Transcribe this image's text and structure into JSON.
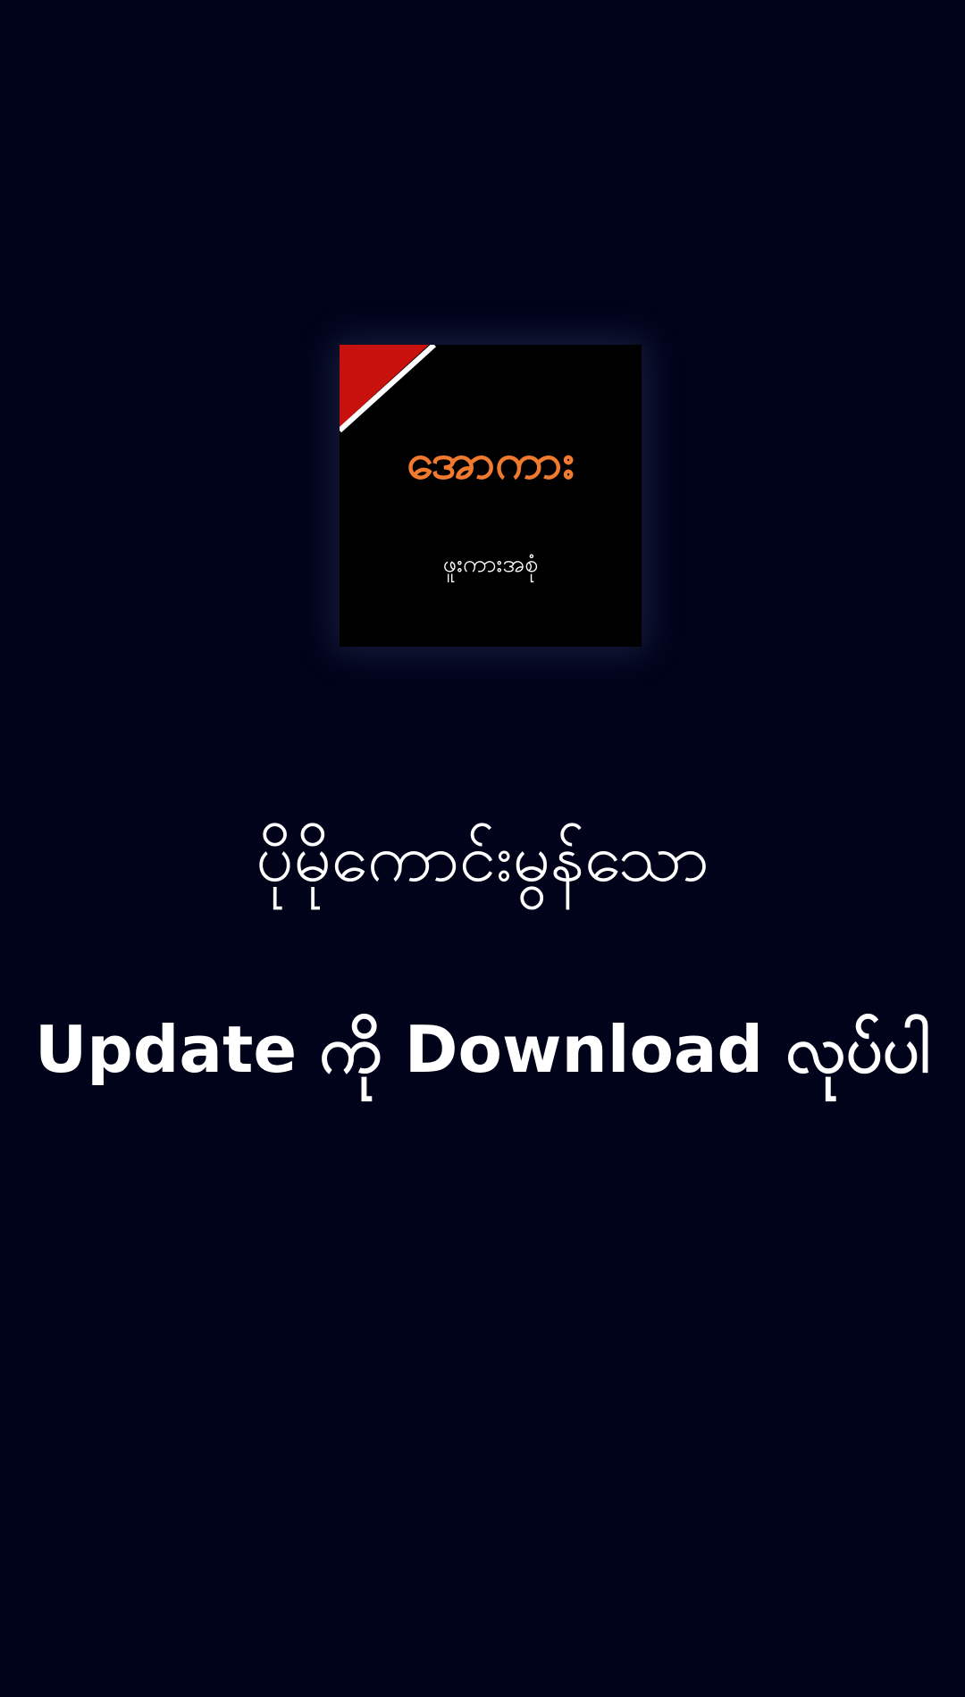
{
  "colors": {
    "background": "#01031a",
    "logo_background": "#000000",
    "logo_title": "#f27a2e",
    "logo_accent_red": "#c8100c",
    "logo_accent_stripe": "#ffffff",
    "text": "#ffffff"
  },
  "logo": {
    "icon": "app-logo-icon",
    "title": "အောကား",
    "subtitle": "ဖူးကားအစုံ"
  },
  "message": {
    "line1": "ပိုမိုကောင်းမွန်သော",
    "line2": "Update ကို Download လုပ်ပါ"
  }
}
